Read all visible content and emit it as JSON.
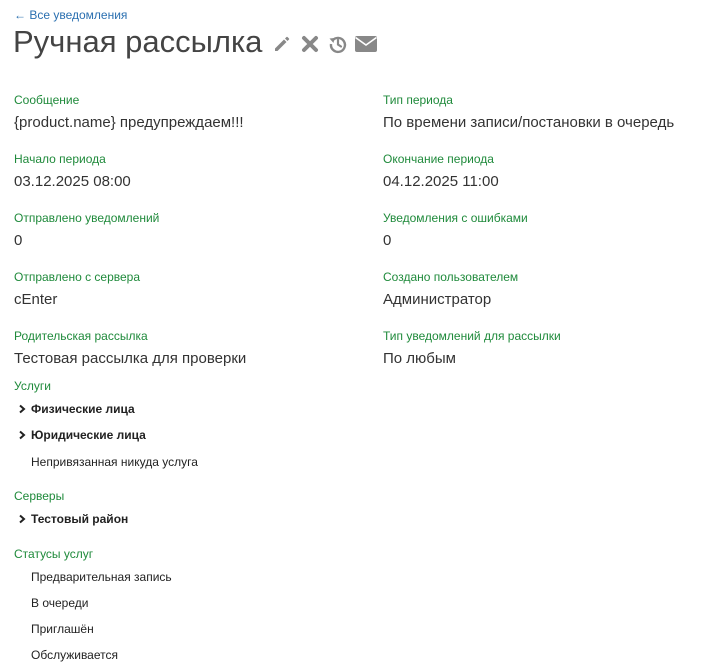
{
  "nav": {
    "back": "← Все уведомления"
  },
  "header": {
    "title": "Ручная рассылка"
  },
  "fields": {
    "message": {
      "label": "Сообщение",
      "value": "{product.name} предупреждаем!!!"
    },
    "period_type": {
      "label": "Тип периода",
      "value": "По времени записи/постановки в очередь"
    },
    "period_start": {
      "label": "Начало периода",
      "value": "03.12.2025 08:00"
    },
    "period_end": {
      "label": "Окончание периода",
      "value": "04.12.2025 11:00"
    },
    "sent_count": {
      "label": "Отправлено уведомлений",
      "value": "0"
    },
    "error_count": {
      "label": "Уведомления с ошибками",
      "value": "0"
    },
    "sent_from_server": {
      "label": "Отправлено с сервера",
      "value": "cEnter"
    },
    "created_by": {
      "label": "Создано пользователем",
      "value": "Администратор"
    },
    "parent_mailing": {
      "label": "Родительская рассылка",
      "value": "Тестовая рассылка для проверки"
    },
    "notification_type": {
      "label": "Тип уведомлений для рассылки",
      "value": "По любым"
    }
  },
  "services": {
    "label": "Услуги",
    "items": [
      "Физические лица",
      "Юридические лица",
      "Непривязанная никуда услуга"
    ]
  },
  "servers": {
    "label": "Серверы",
    "items": [
      "Тестовый район"
    ]
  },
  "statuses": {
    "label": "Статусы услуг",
    "items": [
      "Предварительная запись",
      "В очереди",
      "Приглашён",
      "Обслуживается"
    ]
  },
  "colors": {
    "label": "#1f8a3b",
    "link": "#2a6fb0",
    "icon": "#888888"
  },
  "icons": [
    "pencil-icon",
    "close-icon",
    "history-icon",
    "envelope-icon",
    "chevron-right-icon"
  ]
}
